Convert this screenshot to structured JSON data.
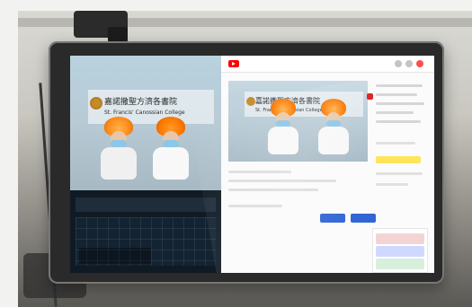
{
  "scene": {
    "left_preview": {
      "school_banner_zh": "嘉諾撒聖方濟各書院",
      "school_banner_en": "St. Francis' Canossian College"
    },
    "right_studio": {
      "school_banner_zh": "嘉諾撒聖方濟各書院",
      "school_banner_en": "St. Francis' Canossian College"
    }
  }
}
